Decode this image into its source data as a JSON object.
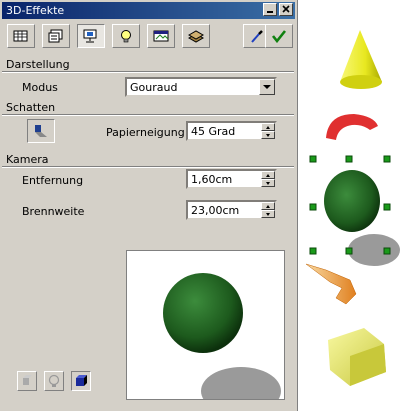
{
  "window": {
    "title": "3D-Effekte"
  },
  "sections": {
    "darstellung": "Darstellung",
    "schatten": "Schatten",
    "kamera": "Kamera"
  },
  "modus": {
    "label": "Modus",
    "value": "Gouraud"
  },
  "papierneigung": {
    "label": "Papierneigung",
    "value": "45 Grad"
  },
  "entfernung": {
    "label": "Entfernung",
    "value": "1,60cm"
  },
  "brennweite": {
    "label": "Brennweite",
    "value": "23,00cm"
  },
  "toolbar": {
    "icons": [
      "geometry-icon",
      "shading-icon",
      "illumination-icon",
      "light-icon",
      "texture-icon",
      "material-icon"
    ],
    "active_index": 2
  },
  "colors": {
    "titlebar": "#0a246a",
    "panel": "#d4d0c8",
    "sphere": "#1e6a1e",
    "shadow": "#9a9a9a",
    "handle": "#1a9a1a"
  }
}
